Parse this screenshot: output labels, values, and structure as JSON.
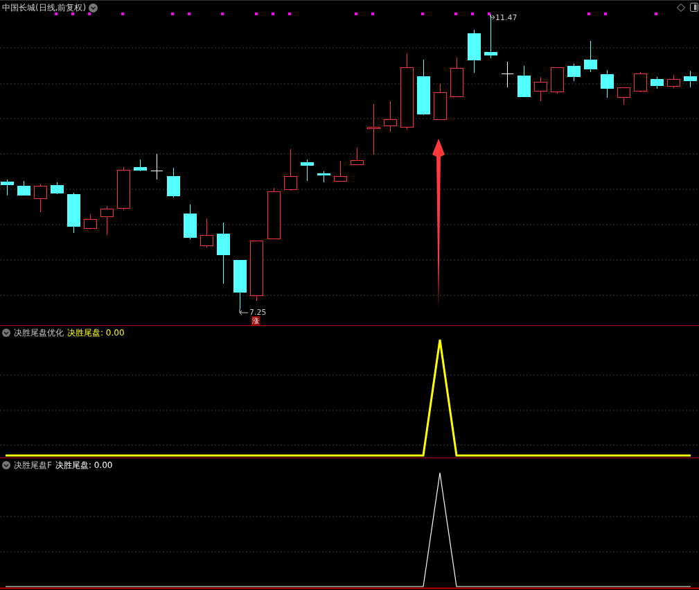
{
  "chart": {
    "title": "中国长城(日线,前复权)",
    "high_label": "11.47",
    "low_label": "7.25",
    "marker": "涨"
  },
  "panels": [
    {
      "name": "决胜尾盘优化",
      "series_label": "决胜尾盘:",
      "value": "0.00",
      "color": "#ffff00"
    },
    {
      "name": "决胜尾盘F",
      "series_label": "决胜尾盘:",
      "value": "0.00",
      "color": "#ffffff"
    }
  ]
}
